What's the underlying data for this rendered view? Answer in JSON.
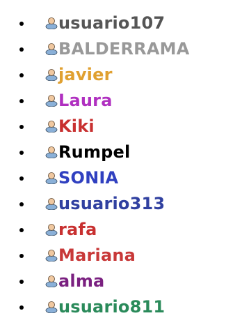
{
  "user_list": {
    "items": [
      {
        "name": "",
        "color": "#000000"
      },
      {
        "name": "usuario107",
        "color": "#555555"
      },
      {
        "name": "BALDERRAMA",
        "color": "#999999"
      },
      {
        "name": "javier",
        "color": "#e0a030"
      },
      {
        "name": "Laura",
        "color": "#b030c0"
      },
      {
        "name": "Kiki",
        "color": "#c83030"
      },
      {
        "name": "Rumpel",
        "color": "#000000"
      },
      {
        "name": "SONIA",
        "color": "#3040c0"
      },
      {
        "name": "usuario313",
        "color": "#3040a0"
      },
      {
        "name": "rafa",
        "color": "#c83030"
      },
      {
        "name": "Mariana",
        "color": "#c83838"
      },
      {
        "name": "alma",
        "color": "#7a2080"
      },
      {
        "name": "usuario811",
        "color": "#2a8a5a"
      }
    ],
    "icon": "user-avatar-icon"
  }
}
